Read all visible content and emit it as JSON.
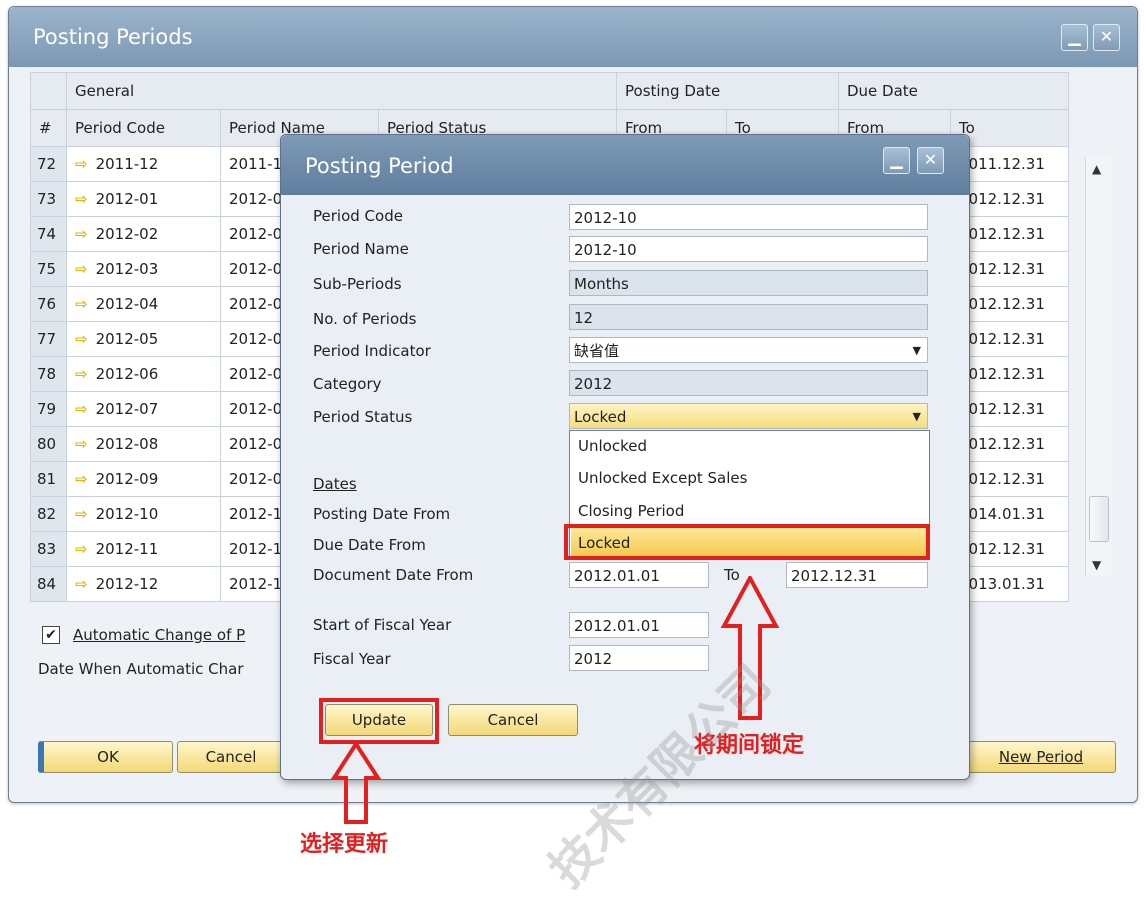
{
  "outer_window": {
    "title": "Posting Periods",
    "group_headers": [
      "General",
      "Posting Date",
      "Due Date"
    ],
    "col_headers": {
      "num": "#",
      "code": "Period Code",
      "name": "Period Name",
      "status": "Period Status",
      "pfrom": "From",
      "pto": "To",
      "dfrom": "From",
      "dto": "To"
    },
    "rows": [
      {
        "n": "72",
        "code": "2011-12",
        "name": "2011-12",
        "due_to": "2011.12.31"
      },
      {
        "n": "73",
        "code": "2012-01",
        "name": "2012-01",
        "due_to": "2012.12.31"
      },
      {
        "n": "74",
        "code": "2012-02",
        "name": "2012-02",
        "due_to": "2012.12.31"
      },
      {
        "n": "75",
        "code": "2012-03",
        "name": "2012-03",
        "due_to": "2012.12.31"
      },
      {
        "n": "76",
        "code": "2012-04",
        "name": "2012-04",
        "due_to": "2012.12.31"
      },
      {
        "n": "77",
        "code": "2012-05",
        "name": "2012-05",
        "due_to": "2012.12.31"
      },
      {
        "n": "78",
        "code": "2012-06",
        "name": "2012-06",
        "due_to": "2012.12.31"
      },
      {
        "n": "79",
        "code": "2012-07",
        "name": "2012-07",
        "due_to": "2012.12.31"
      },
      {
        "n": "80",
        "code": "2012-08",
        "name": "2012-08",
        "due_to": "2012.12.31"
      },
      {
        "n": "81",
        "code": "2012-09",
        "name": "2012-09",
        "due_to": "2012.12.31"
      },
      {
        "n": "82",
        "code": "2012-10",
        "name": "2012-10",
        "due_to": "2014.01.31"
      },
      {
        "n": "83",
        "code": "2012-11",
        "name": "2012-11",
        "due_to": "2012.12.31"
      },
      {
        "n": "84",
        "code": "2012-12",
        "name": "2012-12",
        "due_to": "2013.01.31"
      }
    ],
    "auto_change_label": "Automatic Change of P",
    "auto_change_checked": true,
    "date_when_label": "Date When Automatic Char",
    "ok_label": "OK",
    "cancel_label": "Cancel",
    "new_period_label": "New Period"
  },
  "dialog": {
    "title": "Posting Period",
    "period_code_label": "Period Code",
    "period_code_value": "2012-10",
    "period_name_label": "Period Name",
    "period_name_value": "2012-10",
    "sub_periods_label": "Sub-Periods",
    "sub_periods_value": "Months",
    "no_periods_label": "No. of Periods",
    "no_periods_value": "12",
    "indicator_label": "Period Indicator",
    "indicator_value": "缺省值",
    "category_label": "Category",
    "category_value": "2012",
    "status_label": "Period Status",
    "status_value": "Locked",
    "status_options": [
      "Unlocked",
      "Unlocked Except Sales",
      "Closing Period",
      "Locked"
    ],
    "dates_label": "Dates",
    "posting_from_label": "Posting Date From",
    "due_from_label": "Due Date From",
    "doc_from_label": "Document Date From",
    "doc_from_value": "2012.01.01",
    "to_label": "To",
    "doc_to_value": "2012.12.31",
    "fiscal_start_label": "Start of Fiscal Year",
    "fiscal_start_value": "2012.01.01",
    "fiscal_year_label": "Fiscal Year",
    "fiscal_year_value": "2012",
    "update_label": "Update",
    "cancel_label": "Cancel"
  },
  "annotations": {
    "lock_note": "将期间锁定",
    "update_note": "选择更新"
  },
  "colors": {
    "annotation_red": "#e32020",
    "highlight_gold": "#f2c94c"
  }
}
